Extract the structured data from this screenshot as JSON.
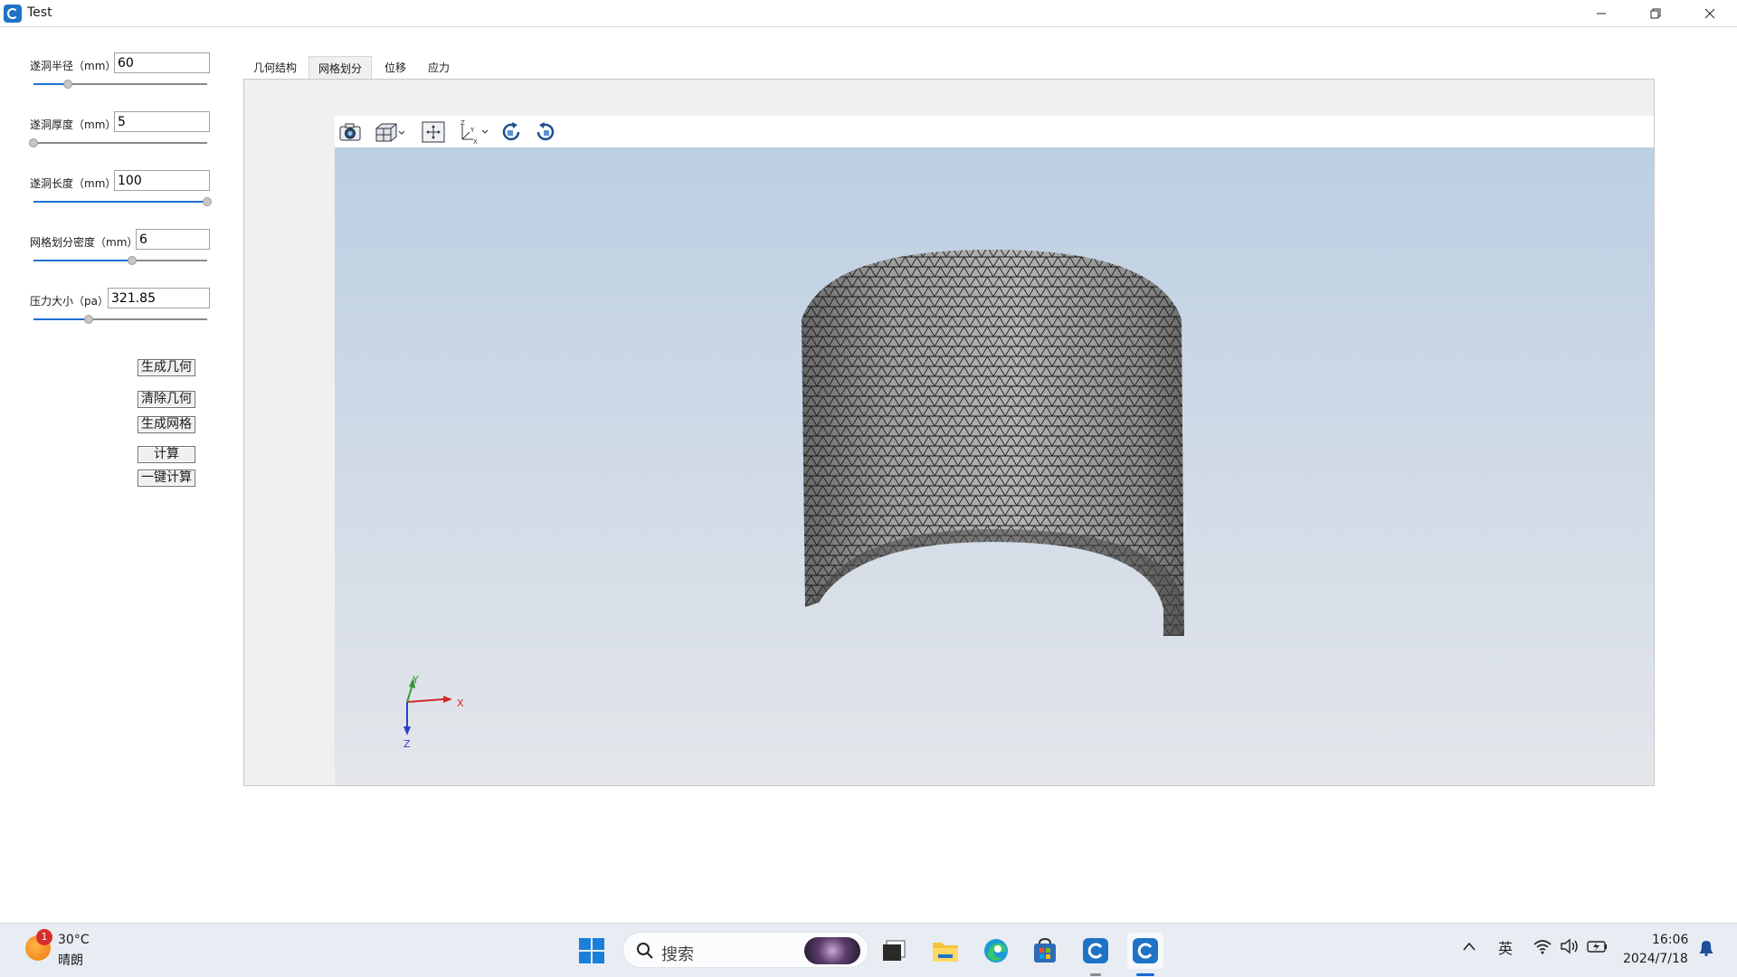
{
  "window": {
    "title": "Test",
    "minimize_icon": "minimize-icon",
    "maximize_icon": "restore-icon",
    "close_icon": "close-icon"
  },
  "params": [
    {
      "label": "遂洞半径（mm）",
      "value": "60",
      "slider_fraction": 0.2
    },
    {
      "label": "遂洞厚度（mm）",
      "value": "5",
      "slider_fraction": 0.0
    },
    {
      "label": "遂洞长度（mm）",
      "value": "100",
      "slider_fraction": 1.0
    },
    {
      "label": "网格划分密度（mm）",
      "value": "6",
      "slider_fraction": 0.57
    },
    {
      "label": "压力大小（pa）",
      "value": "321.85",
      "slider_fraction": 0.32
    }
  ],
  "buttons": {
    "gen_geometry": "生成几何",
    "clear_geometry": "清除几何",
    "gen_mesh": "生成网格",
    "compute": "计算",
    "one_click": "一键计算"
  },
  "tabs": [
    {
      "label": "几何结构",
      "active": false
    },
    {
      "label": "网格划分",
      "active": true
    },
    {
      "label": "位移",
      "active": false
    },
    {
      "label": "应力",
      "active": false
    }
  ],
  "viewer_toolbar": [
    "camera-icon",
    "view-cube-icon",
    "fit-all-icon",
    "axes-icon",
    "rotate-cw-icon",
    "rotate-ccw-icon"
  ],
  "axes": {
    "x": "X",
    "y": "Y",
    "z": "Z"
  },
  "colors": {
    "accent": "#1f6fd1",
    "mesh_fill": "#8c8c8c",
    "mesh_line": "#1a1a1a",
    "axis_x": "#d12b2b",
    "axis_y": "#2f9b2f",
    "axis_z": "#2b3fd1"
  },
  "taskbar": {
    "weather_temp": "30°C",
    "weather_desc": "晴朗",
    "weather_badge": "1",
    "search_placeholder": "搜索",
    "ime": "英",
    "time": "16:06",
    "date": "2024/7/18"
  }
}
